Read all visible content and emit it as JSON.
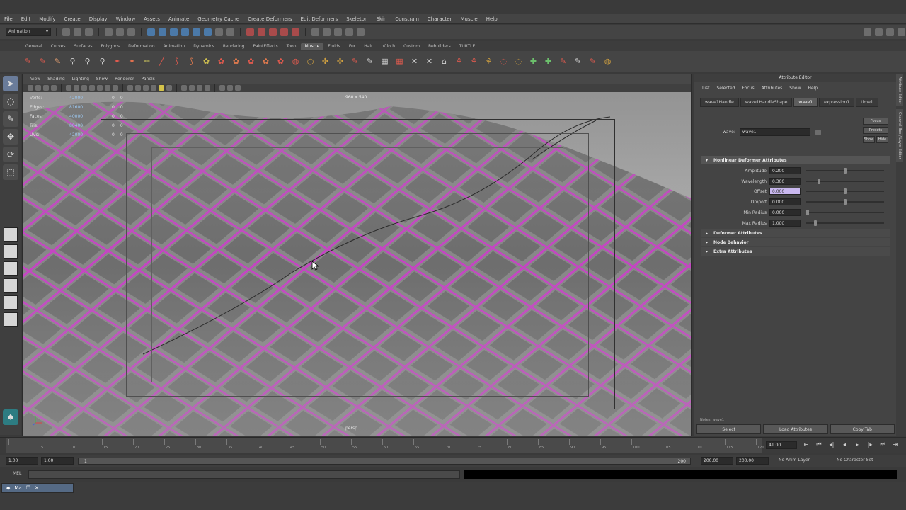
{
  "menubar": {
    "items": [
      "File",
      "Edit",
      "Modify",
      "Create",
      "Display",
      "Window",
      "Assets",
      "Animate",
      "Geometry Cache",
      "Create Deformers",
      "Edit Deformers",
      "Skeleton",
      "Skin",
      "Constrain",
      "Character",
      "Muscle",
      "Help"
    ]
  },
  "status_line": {
    "mode": "Animation"
  },
  "shelf": {
    "tabs": [
      "General",
      "Curves",
      "Surfaces",
      "Polygons",
      "Deformation",
      "Animation",
      "Dynamics",
      "Rendering",
      "PaintEffects",
      "Toon",
      "Muscle",
      "Fluids",
      "Fur",
      "Hair",
      "nCloth",
      "Custom",
      "Rebuilders",
      "TURTLE"
    ],
    "active_tab": "Muscle"
  },
  "viewport_panel": {
    "menu": [
      "View",
      "Shading",
      "Lighting",
      "Show",
      "Renderer",
      "Panels"
    ],
    "hud": [
      {
        "label": "Verts:",
        "v1": "42000",
        "v2": "0",
        "v3": "0"
      },
      {
        "label": "Edges:",
        "v1": "81600",
        "v2": "0",
        "v3": "0"
      },
      {
        "label": "Faces:",
        "v1": "40000",
        "v2": "0",
        "v3": "0"
      },
      {
        "label": "Tris:",
        "v1": "80400",
        "v2": "0",
        "v3": "0"
      },
      {
        "label": "UVs:",
        "v1": "42000",
        "v2": "0",
        "v3": "0"
      }
    ],
    "resolution": "960 x 540",
    "camera": "persp"
  },
  "attribute_editor": {
    "title": "Attribute Editor",
    "menu": [
      "List",
      "Selected",
      "Focus",
      "Attributes",
      "Show",
      "Help"
    ],
    "tabs": [
      "wave1Handle",
      "wave1HandleShape",
      "wave1",
      "expression1",
      "time1"
    ],
    "active_tab": "wave1",
    "side_buttons": [
      "Focus",
      "Presets",
      "Show",
      "Hide"
    ],
    "node_label": "wave:",
    "node_value": "wave1",
    "sections": {
      "nonlinear": "Nonlinear Deformer Attributes",
      "deformer": "Deformer Attributes",
      "node_behavior": "Node Behavior",
      "extra": "Extra Attributes"
    },
    "attributes": [
      {
        "label": "Amplitude",
        "value": "0.200",
        "level": 0.5,
        "highlight": false
      },
      {
        "label": "Wavelength",
        "value": "0.300",
        "level": 0.15,
        "highlight": false
      },
      {
        "label": "Offset",
        "value": "0.000",
        "level": 0.5,
        "highlight": true
      },
      {
        "label": "Dropoff",
        "value": "0.000",
        "level": 0.5,
        "highlight": false
      },
      {
        "label": "Min Radius",
        "value": "0.000",
        "level": 0.0,
        "highlight": false
      },
      {
        "label": "Max Radius",
        "value": "1.000",
        "level": 0.1,
        "highlight": false
      }
    ],
    "notes_label": "Notes: wave1",
    "footer": [
      "Select",
      "Load Attributes",
      "Copy Tab"
    ]
  },
  "right_tabs": [
    "Attribute Editor",
    "Channel Box / Layer Editor"
  ],
  "time_slider": {
    "tick_labels": [
      "1",
      "5",
      "10",
      "15",
      "20",
      "25",
      "30",
      "35",
      "40",
      "45",
      "50",
      "55",
      "60",
      "65",
      "70",
      "75",
      "80",
      "85",
      "90",
      "95",
      "100",
      "105",
      "110",
      "115",
      "120"
    ],
    "current_frame": "41.00",
    "playback": [
      "⇤",
      "⏮",
      "◂|",
      "◂",
      "▸",
      "|▸",
      "⏭",
      "⇥"
    ]
  },
  "range_slider": {
    "start_time": "1.00",
    "playback_start": "1.00",
    "range_start": "1",
    "range_end": "200",
    "playback_end": "200.00",
    "end_time": "200.00",
    "anim_layer": "No Anim Layer",
    "character_set": "No Character Set"
  },
  "command_line": {
    "label": "MEL"
  },
  "taskbar": {
    "window_label": "Ma"
  }
}
